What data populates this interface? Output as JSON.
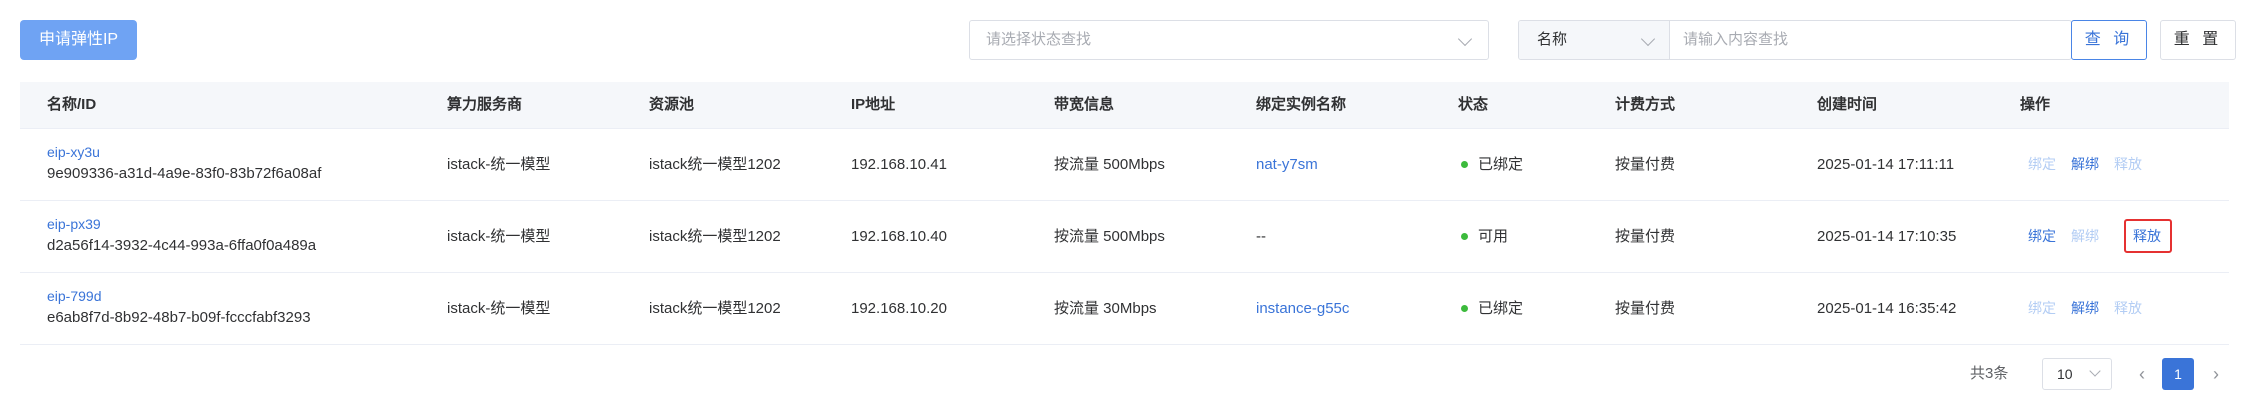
{
  "toolbar": {
    "apply_label": "申请弹性IP",
    "status_placeholder": "请选择状态查找",
    "field_select_value": "名称",
    "search_placeholder": "请输入内容查找",
    "query_label": "查 询",
    "reset_label": "重 置"
  },
  "table": {
    "headers": [
      "名称/ID",
      "算力服务商",
      "资源池",
      "IP地址",
      "带宽信息",
      "绑定实例名称",
      "状态",
      "计费方式",
      "创建时间",
      "操作"
    ],
    "rows": [
      {
        "name": "eip-xy3u",
        "id": "9e909336-a31d-4a9e-83f0-83b72f6a08af",
        "provider": "istack-统一模型",
        "pool": "istack统一模型1202",
        "ip": "192.168.10.41",
        "bandwidth": "按流量 500Mbps",
        "instance": "nat-y7sm",
        "status": "已绑定",
        "billing": "按量付费",
        "created": "2025-01-14 17:11:11",
        "actions": [
          "绑定",
          "解绑",
          "释放"
        ]
      },
      {
        "name": "eip-px39",
        "id": "d2a56f14-3932-4c44-993a-6ffa0f0a489a",
        "provider": "istack-统一模型",
        "pool": "istack统一模型1202",
        "ip": "192.168.10.40",
        "bandwidth": "按流量 500Mbps",
        "instance": "--",
        "status": "可用",
        "billing": "按量付费",
        "created": "2025-01-14 17:10:35",
        "actions": [
          "绑定",
          "解绑",
          "释放"
        ]
      },
      {
        "name": "eip-799d",
        "id": "e6ab8f7d-8b92-48b7-b09f-fcccfabf3293",
        "provider": "istack-统一模型",
        "pool": "istack统一模型1202",
        "ip": "192.168.10.20",
        "bandwidth": "按流量 30Mbps",
        "instance": "instance-g55c",
        "status": "已绑定",
        "billing": "按量付费",
        "created": "2025-01-14 16:35:42",
        "actions": [
          "绑定",
          "解绑",
          "释放"
        ]
      }
    ]
  },
  "pagination": {
    "total": "共3条",
    "page_size": "10",
    "current_page": "1",
    "prev_icon": "‹",
    "next_icon": "›"
  },
  "colors": {
    "primary": "#3a74d8",
    "primary_light": "#6fa3f3",
    "disabled_link": "#b3cdf4",
    "status_dot": "#3cba3c",
    "highlight": "#e53131"
  }
}
